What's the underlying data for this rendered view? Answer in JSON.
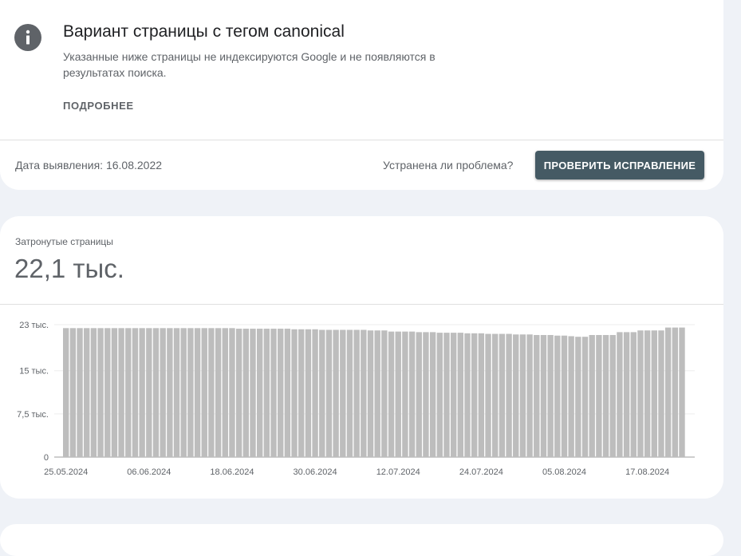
{
  "issue": {
    "title": "Вариант страницы с тегом canonical",
    "description": "Указанные ниже страницы не индексируются Google и не появляются в результатах поиска.",
    "more_label": "ПОДРОБНЕЕ",
    "detection_date": "Дата выявления: 16.08.2022",
    "resolved_question": "Устранена ли проблема?",
    "validate_label": "ПРОВЕРИТЬ ИСПРАВЛЕНИЕ",
    "icon": "info-icon"
  },
  "summary": {
    "label": "Затронутые страницы",
    "value": "22,1 тыс."
  },
  "colors": {
    "bar": "#bdbdbd",
    "button": "#455a64",
    "background": "#eff2f7"
  },
  "chart_data": {
    "type": "bar",
    "title": "",
    "xlabel": "",
    "ylabel": "",
    "ylim": [
      0,
      23000
    ],
    "y_ticks": [
      {
        "value": 0,
        "label": "0"
      },
      {
        "value": 7500,
        "label": "7,5 тыс."
      },
      {
        "value": 15000,
        "label": "15 тыс."
      },
      {
        "value": 23000,
        "label": "23 тыс."
      }
    ],
    "x_tick_labels": [
      "25.05.2024",
      "06.06.2024",
      "18.06.2024",
      "30.06.2024",
      "12.07.2024",
      "24.07.2024",
      "05.08.2024",
      "17.08.2024"
    ],
    "grid": true,
    "x": [
      "25.05.2024",
      "26.05.2024",
      "27.05.2024",
      "28.05.2024",
      "29.05.2024",
      "30.05.2024",
      "31.05.2024",
      "01.06.2024",
      "02.06.2024",
      "03.06.2024",
      "04.06.2024",
      "05.06.2024",
      "06.06.2024",
      "07.06.2024",
      "08.06.2024",
      "09.06.2024",
      "10.06.2024",
      "11.06.2024",
      "12.06.2024",
      "13.06.2024",
      "14.06.2024",
      "15.06.2024",
      "16.06.2024",
      "17.06.2024",
      "18.06.2024",
      "19.06.2024",
      "20.06.2024",
      "21.06.2024",
      "22.06.2024",
      "23.06.2024",
      "24.06.2024",
      "25.06.2024",
      "26.06.2024",
      "27.06.2024",
      "28.06.2024",
      "29.06.2024",
      "30.06.2024",
      "01.07.2024",
      "02.07.2024",
      "03.07.2024",
      "04.07.2024",
      "05.07.2024",
      "06.07.2024",
      "07.07.2024",
      "08.07.2024",
      "09.07.2024",
      "10.07.2024",
      "11.07.2024",
      "12.07.2024",
      "13.07.2024",
      "14.07.2024",
      "15.07.2024",
      "16.07.2024",
      "17.07.2024",
      "18.07.2024",
      "19.07.2024",
      "20.07.2024",
      "21.07.2024",
      "22.07.2024",
      "23.07.2024",
      "24.07.2024",
      "25.07.2024",
      "26.07.2024",
      "27.07.2024",
      "28.07.2024",
      "29.07.2024",
      "30.07.2024",
      "31.07.2024",
      "01.08.2024",
      "02.08.2024",
      "03.08.2024",
      "04.08.2024",
      "05.08.2024",
      "06.08.2024",
      "07.08.2024",
      "08.08.2024",
      "09.08.2024",
      "10.08.2024",
      "11.08.2024",
      "12.08.2024",
      "13.08.2024",
      "14.08.2024",
      "15.08.2024",
      "16.08.2024",
      "17.08.2024",
      "18.08.2024",
      "19.08.2024",
      "20.08.2024"
    ],
    "values": [
      22400,
      22400,
      22400,
      22400,
      22400,
      22400,
      22400,
      22400,
      22400,
      22400,
      22400,
      22400,
      22400,
      22400,
      22400,
      22400,
      22400,
      22400,
      22400,
      22400,
      22400,
      22400,
      22400,
      22400,
      22400,
      22300,
      22300,
      22300,
      22300,
      22300,
      22300,
      22300,
      22300,
      22200,
      22200,
      22200,
      22200,
      22100,
      22100,
      22100,
      22100,
      22100,
      22100,
      22100,
      22000,
      22000,
      22000,
      21800,
      21800,
      21800,
      21800,
      21700,
      21700,
      21700,
      21600,
      21600,
      21600,
      21600,
      21500,
      21500,
      21500,
      21400,
      21400,
      21400,
      21400,
      21300,
      21300,
      21300,
      21200,
      21200,
      21200,
      21100,
      21100,
      21000,
      20900,
      20900,
      21200,
      21200,
      21200,
      21200,
      21700,
      21700,
      21700,
      22000,
      22000,
      22000,
      22000,
      22500,
      22500,
      22500
    ]
  }
}
